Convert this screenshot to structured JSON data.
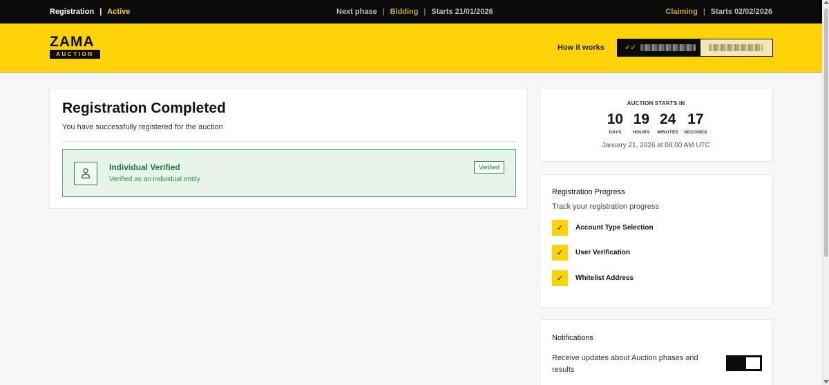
{
  "phase_bar": {
    "current_label": "Registration",
    "current_status": "Active",
    "next_label": "Next phase",
    "next_phase": "Bidding",
    "next_start": "Starts 21/01/2026",
    "later_phase": "Claiming",
    "later_start": "Starts 02/02/2026",
    "separator": "|"
  },
  "header": {
    "logo_word": "ZAMA",
    "logo_badge": "AUCTION",
    "how_it_works": "How it works",
    "wallet_icon": "double-check-icon"
  },
  "main": {
    "title": "Registration Completed",
    "subtitle": "You have successfully registered for the auction",
    "verified": {
      "title": "Individual Verified",
      "subtitle": "Verified as an individual entity",
      "badge": "Verified",
      "icon": "person-icon"
    }
  },
  "countdown": {
    "label": "AUCTION STARTS IN",
    "units": [
      {
        "value": "10",
        "label": "DAYS"
      },
      {
        "value": "19",
        "label": "HOURS"
      },
      {
        "value": "24",
        "label": "MINUTES"
      },
      {
        "value": "17",
        "label": "SECONDS"
      }
    ],
    "date": "January 21, 2026 at 08:00 AM UTC"
  },
  "progress": {
    "title": "Registration Progress",
    "subtitle": "Track your registration progress",
    "check_glyph": "✓",
    "items": [
      {
        "label": "Account Type Selection"
      },
      {
        "label": "User Verification"
      },
      {
        "label": "Whitelist Address"
      }
    ]
  },
  "notifications": {
    "title": "Notifications",
    "text": "Receive updates about Auction phases and results",
    "enabled": true
  },
  "colors": {
    "accent": "#ffd208",
    "dark": "#0a0a0a",
    "success": "#1d7a3d"
  }
}
